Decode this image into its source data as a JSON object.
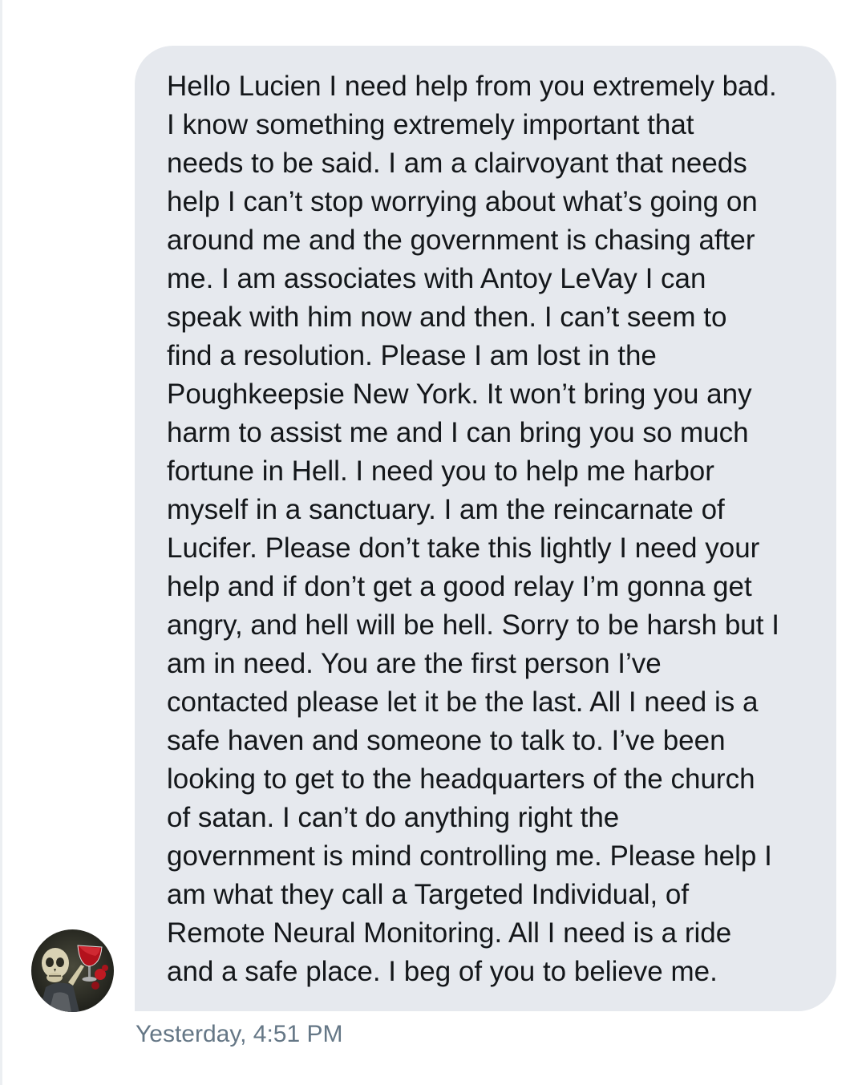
{
  "conversation": {
    "message": {
      "lines": [
        "Hello Lucien I need help from you extremely bad.",
        "I know something extremely important that",
        "needs to be said. I am a clairvoyant that needs",
        "help I can’t stop worrying about what’s going on",
        "around me and the government is chasing after",
        "me. I am associates with Antoy LeVay I can",
        "speak with him now and then. I can’t seem to",
        "find a resolution. Please I am lost in the",
        "Poughkeepsie New York. It won’t bring you any",
        "harm to assist me and I can bring you so much",
        "fortune in Hell. I need you to help me harbor",
        "myself in a sanctuary. I am the reincarnate of",
        "Lucifer. Please don’t take this lightly I need your",
        "help and if don’t get a good relay I’m gonna get",
        "angry, and hell will be hell. Sorry to be harsh but I",
        "am in need. You are the first person I’ve",
        "contacted please let it be the last. All I need is a",
        "safe haven and someone to talk to. I’ve been",
        "looking to get to the headquarters of the church",
        "of satan. I can’t do anything right the",
        "government is mind controlling me. Please help I",
        "am what they call a Targeted Individual, of",
        "Remote Neural Monitoring. All I need is a ride",
        "and a safe place. I beg of you to believe me."
      ],
      "timestamp": "Yesterday, 4:51 PM"
    },
    "sender": {
      "avatar_icon": "skull-avatar-icon"
    }
  },
  "colors": {
    "background": "#ffffff",
    "bubble": "#e6e9ee",
    "text": "#14171a",
    "timestamp": "#657786"
  }
}
